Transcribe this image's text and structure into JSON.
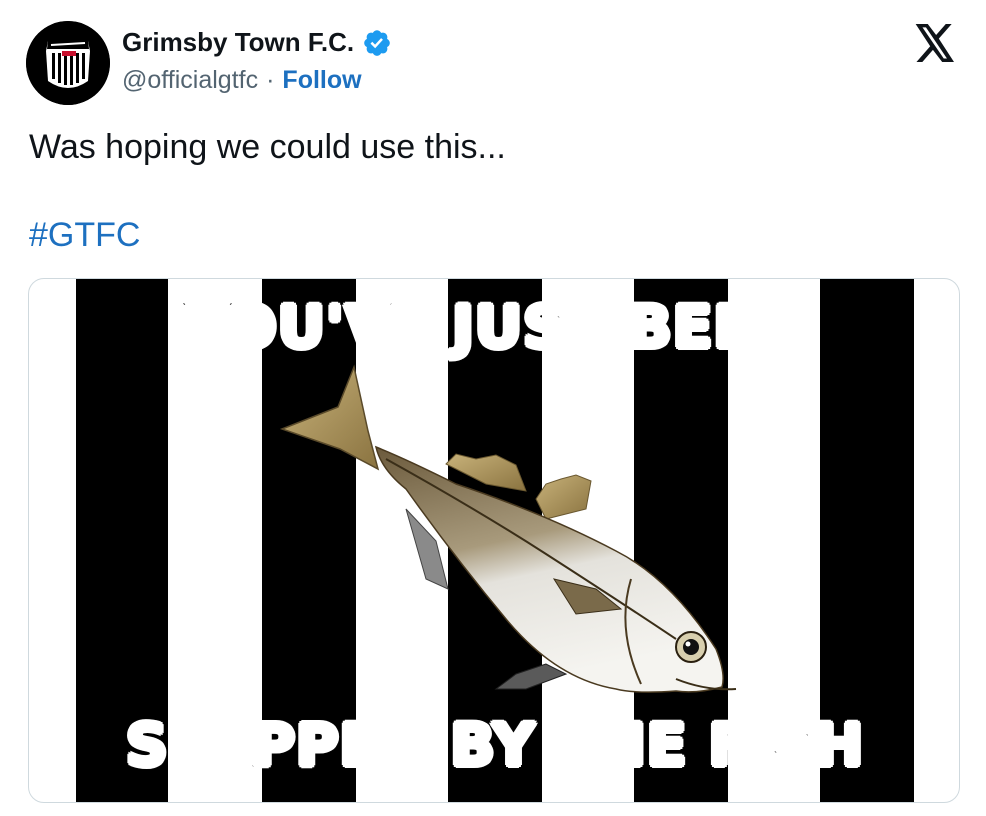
{
  "tweet": {
    "author": {
      "name": "Grimsby Town F.C.",
      "handle": "@officialgtfc",
      "separator": "·",
      "follow_label": "Follow",
      "avatar_icon": "grimsby-town-crest-icon",
      "verified_icon": "verified-badge-icon"
    },
    "platform_icon": "x-logo-icon",
    "text": "Was hoping we could use this...",
    "hashtag": "#GTFC",
    "media": {
      "top_caption": "YOU'VE JUST BEEN",
      "bottom_caption": "SLAPPED BY THE FISH",
      "image_icon": "fish-icon"
    }
  },
  "colors": {
    "link": "#1d70c0",
    "verified": "#1d9bf0",
    "text": "#0f1419",
    "secondary": "#536471",
    "card_border": "#cfd9de"
  }
}
